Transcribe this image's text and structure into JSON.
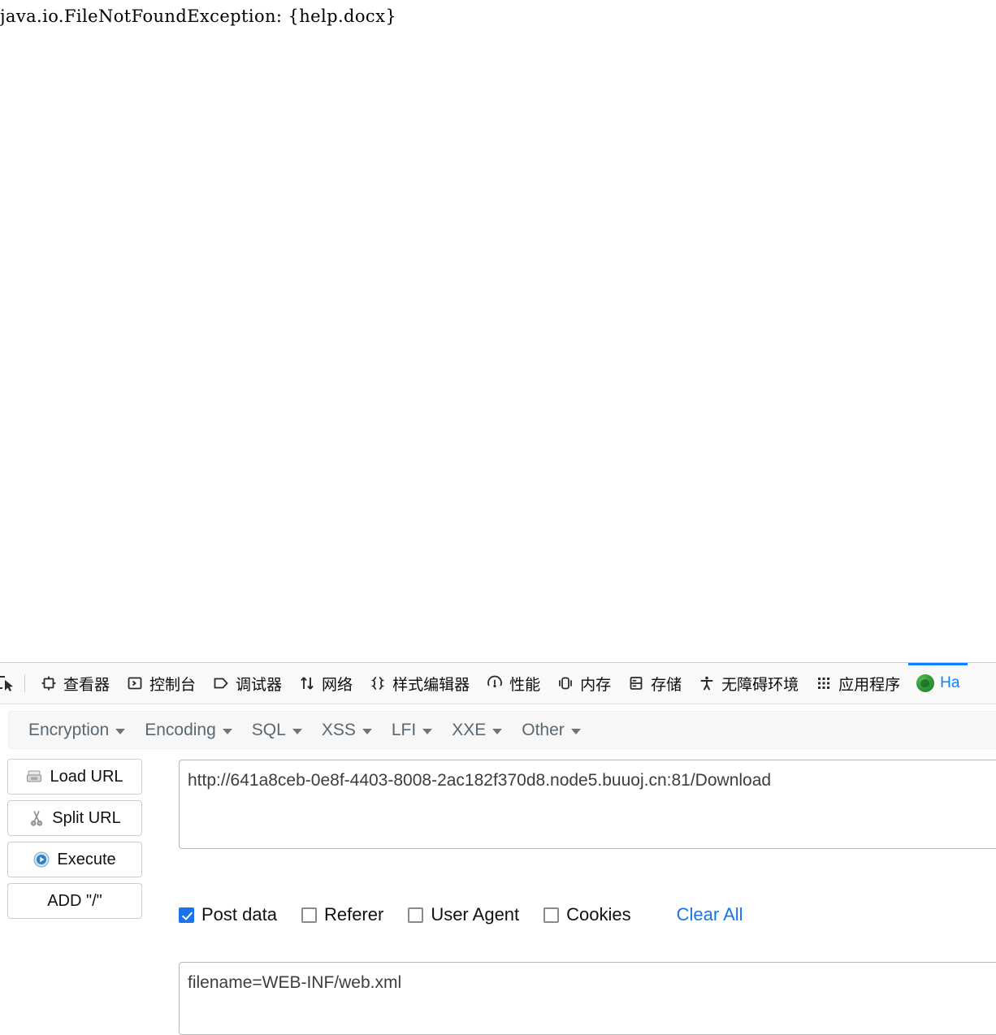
{
  "page": {
    "exception_text": "java.io.FileNotFoundException: {help.docx}"
  },
  "devtools": {
    "picker_icon": "element-picker-icon",
    "tabs": [
      {
        "label": "查看器",
        "icon": "inspector-icon",
        "active": false
      },
      {
        "label": "控制台",
        "icon": "console-icon",
        "active": false
      },
      {
        "label": "调试器",
        "icon": "debugger-icon",
        "active": false
      },
      {
        "label": "网络",
        "icon": "network-icon",
        "active": false
      },
      {
        "label": "样式编辑器",
        "icon": "style-editor-icon",
        "active": false
      },
      {
        "label": "性能",
        "icon": "performance-icon",
        "active": false
      },
      {
        "label": "内存",
        "icon": "memory-icon",
        "active": false
      },
      {
        "label": "存储",
        "icon": "storage-icon",
        "active": false
      },
      {
        "label": "无障碍环境",
        "icon": "accessibility-icon",
        "active": false
      },
      {
        "label": "应用程序",
        "icon": "application-icon",
        "active": false
      },
      {
        "label": "Ha",
        "icon": "hackbar-logo-icon",
        "active": true
      }
    ],
    "active_tab_color": "#0a84ff"
  },
  "hackbar": {
    "menu": [
      {
        "label": "Encryption"
      },
      {
        "label": "Encoding"
      },
      {
        "label": "SQL"
      },
      {
        "label": "XSS"
      },
      {
        "label": "LFI"
      },
      {
        "label": "XXE"
      },
      {
        "label": "Other"
      }
    ],
    "buttons": [
      {
        "label": "Load URL",
        "icon": "load-url-icon"
      },
      {
        "label": "Split URL",
        "icon": "scissors-icon"
      },
      {
        "label": "Execute",
        "icon": "execute-play-icon"
      },
      {
        "label": "ADD \"/\"",
        "icon": "none"
      }
    ],
    "url_field": {
      "value": "http://641a8ceb-0e8f-4403-8008-2ac182f370d8.node5.buuoj.cn:81/Download",
      "placeholder": ""
    },
    "options": [
      {
        "label": "Post data",
        "checked": true
      },
      {
        "label": "Referer",
        "checked": false
      },
      {
        "label": "User Agent",
        "checked": false
      },
      {
        "label": "Cookies",
        "checked": false
      }
    ],
    "clear_all_label": "Clear All",
    "clear_all_color": "#1a73e8",
    "postdata_field": {
      "value": "filename=WEB-INF/web.xml",
      "placeholder": ""
    }
  }
}
